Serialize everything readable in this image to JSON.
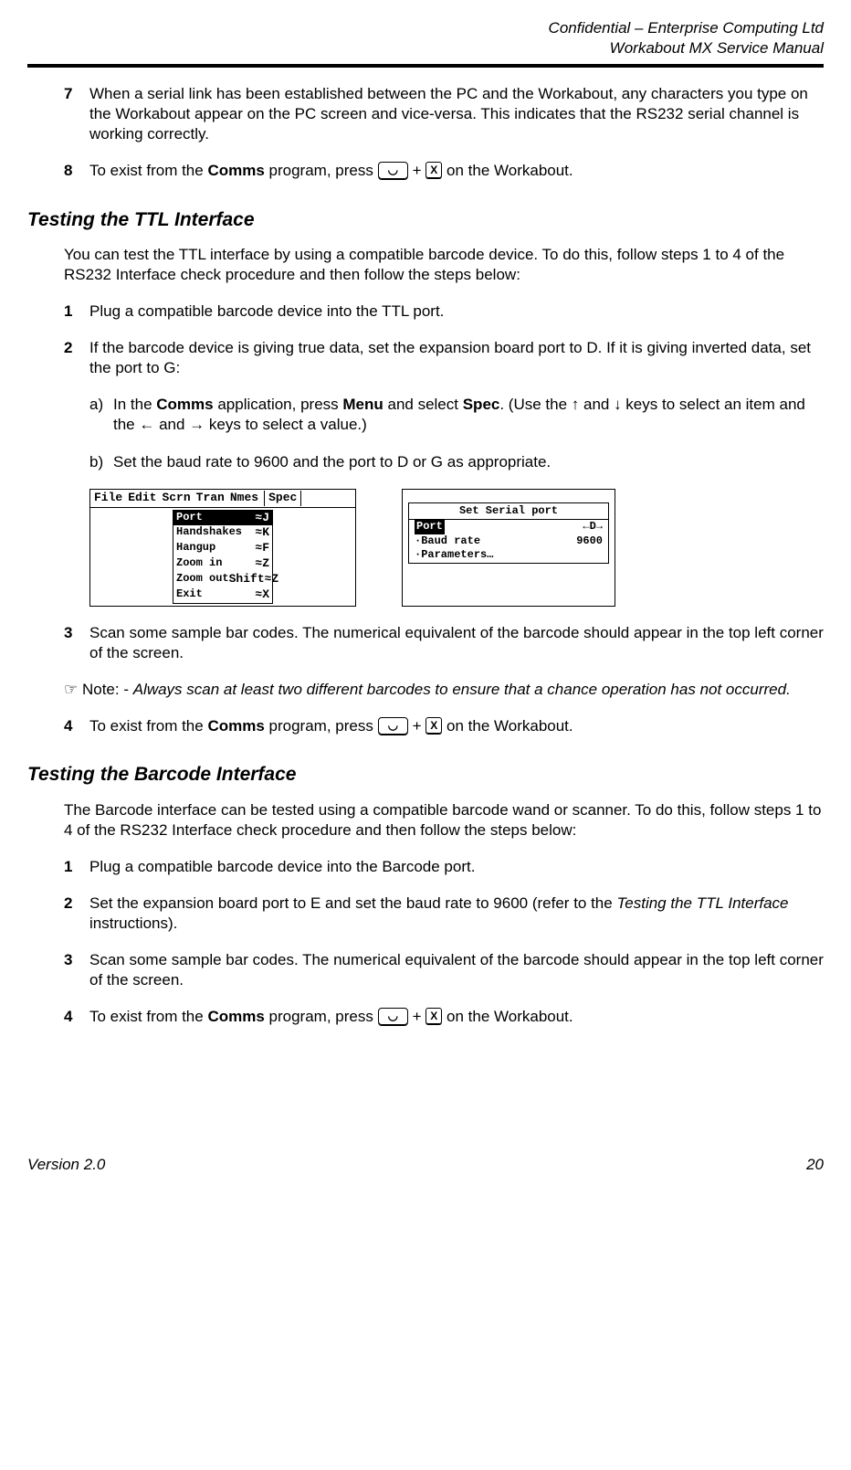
{
  "header": {
    "line1": "Confidential – Enterprise Computing Ltd",
    "line2": "Workabout MX Service Manual"
  },
  "top_items": {
    "n7": {
      "num": "7",
      "text": "When a serial link has been established between the PC and the Workabout, any characters you type on the Workabout appear on the PC screen and vice-versa. This indicates that the RS232 serial channel is working correctly."
    },
    "n8": {
      "num": "8",
      "pre": "To exist from the ",
      "bold": "Comms",
      "post": " program, press ",
      "tail": " on the Workabout."
    }
  },
  "keys": {
    "psion": "◡",
    "x": "X",
    "plus": " + "
  },
  "ttl": {
    "heading": "Testing the TTL Interface",
    "intro": "You can test the TTL interface by using a compatible barcode device. To do this, follow steps 1 to 4 of the RS232 Interface check procedure and then follow the steps below:",
    "n1": {
      "num": "1",
      "text": "Plug a compatible barcode device into the TTL port."
    },
    "n2": {
      "num": "2",
      "text": "If the barcode device is giving true data, set the expansion board port to D. If it is giving inverted data, set the port to G:"
    },
    "a": {
      "lbl": "a)",
      "t1": "In the ",
      "b1": "Comms",
      "t2": " application, press ",
      "b2": "Menu",
      "t3": " and select ",
      "b3": "Spec",
      "t4": ". (Use the ↑ and ↓ keys to select an item and the ← and → keys to select a value.)"
    },
    "b": {
      "lbl": "b)",
      "text": "Set the baud rate to 9600 and the port to D or G as appropriate."
    },
    "n3": {
      "num": "3",
      "text": "Scan some sample bar codes. The numerical equivalent of the barcode should appear in the top left corner of the screen."
    },
    "note": {
      "pre": "☞ Note: - ",
      "it": "Always scan at least two different barcodes to ensure that a chance operation has not occurred."
    },
    "n4": {
      "num": "4",
      "pre": "To exist from the ",
      "bold": "Comms",
      "post": " program, press ",
      "tail": " on the Workabout."
    }
  },
  "lcd1": {
    "menubar": [
      "File",
      "Edit",
      "Scrn",
      "Tran",
      "Nmes",
      "Spec"
    ],
    "menu": [
      {
        "l": "Port",
        "r": "≈J"
      },
      {
        "l": "Handshakes",
        "r": "≈K"
      },
      {
        "l": "Hangup",
        "r": "≈F"
      },
      {
        "l": "Zoom in",
        "r": "≈Z"
      },
      {
        "l": "Zoom out",
        "r": "Shift≈Z"
      },
      {
        "l": "Exit",
        "r": "≈X"
      }
    ]
  },
  "lcd2": {
    "title": "Set Serial port",
    "rows": [
      {
        "l": "Port",
        "r": "←D→"
      },
      {
        "l": "Baud rate",
        "r": "9600"
      },
      {
        "l": "Parameters…",
        "r": ""
      }
    ]
  },
  "barcode": {
    "heading": "Testing the Barcode Interface",
    "intro": "The Barcode interface can be tested using a compatible barcode wand or scanner. To do this, follow steps 1 to 4 of the RS232 Interface check procedure and then follow the steps below:",
    "n1": {
      "num": "1",
      "text": "Plug a compatible barcode device into the Barcode port."
    },
    "n2": {
      "num": "2",
      "t1": "Set the expansion board port to E and set the baud rate to 9600 (refer to the ",
      "it": "Testing the TTL Interface",
      "t2": " instructions)."
    },
    "n3": {
      "num": "3",
      "text": "Scan some sample bar codes. The numerical equivalent of the barcode should appear in the top left corner of the screen."
    },
    "n4": {
      "num": "4",
      "pre": "To exist from the ",
      "bold": "Comms",
      "post": " program, press ",
      "tail": " on the Workabout."
    }
  },
  "footer": {
    "version": "Version 2.0",
    "page": "20"
  }
}
